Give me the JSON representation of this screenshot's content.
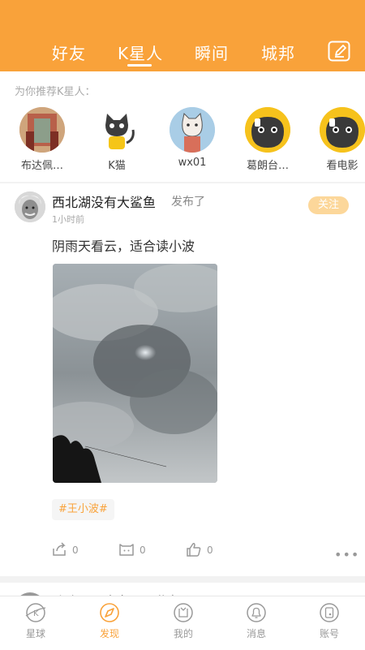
{
  "header": {
    "tabs": [
      {
        "label": "好友"
      },
      {
        "label": "K星人"
      },
      {
        "label": "瞬间"
      },
      {
        "label": "城邦"
      }
    ],
    "active_tab": "K星人",
    "accent_color": "#f9a23a"
  },
  "recommend": {
    "title": "为你推荐K星人：",
    "users": [
      {
        "name": "布达佩…"
      },
      {
        "name": "K猫"
      },
      {
        "name": "wx01"
      },
      {
        "name": "葛朗台…"
      },
      {
        "name": "看电影"
      }
    ]
  },
  "post": {
    "username": "西北湖没有大鲨鱼",
    "action": "发布了",
    "time": "1小时前",
    "follow_label": "关注",
    "text": "阴雨天看云，适合读小波",
    "topic": "#王小波#",
    "share_count": "0",
    "comment_count": "0",
    "like_count": "0",
    "more_label": "•••"
  },
  "next_post": {
    "username": "吐咯是只大冬瓜",
    "action": "分享了"
  },
  "bottom_nav": {
    "items": [
      {
        "label": "星球",
        "icon": "planet-icon"
      },
      {
        "label": "发现",
        "icon": "compass-icon"
      },
      {
        "label": "我的",
        "icon": "profile-icon"
      },
      {
        "label": "消息",
        "icon": "bell-icon"
      },
      {
        "label": "账号",
        "icon": "account-icon"
      }
    ],
    "active": "发现"
  }
}
